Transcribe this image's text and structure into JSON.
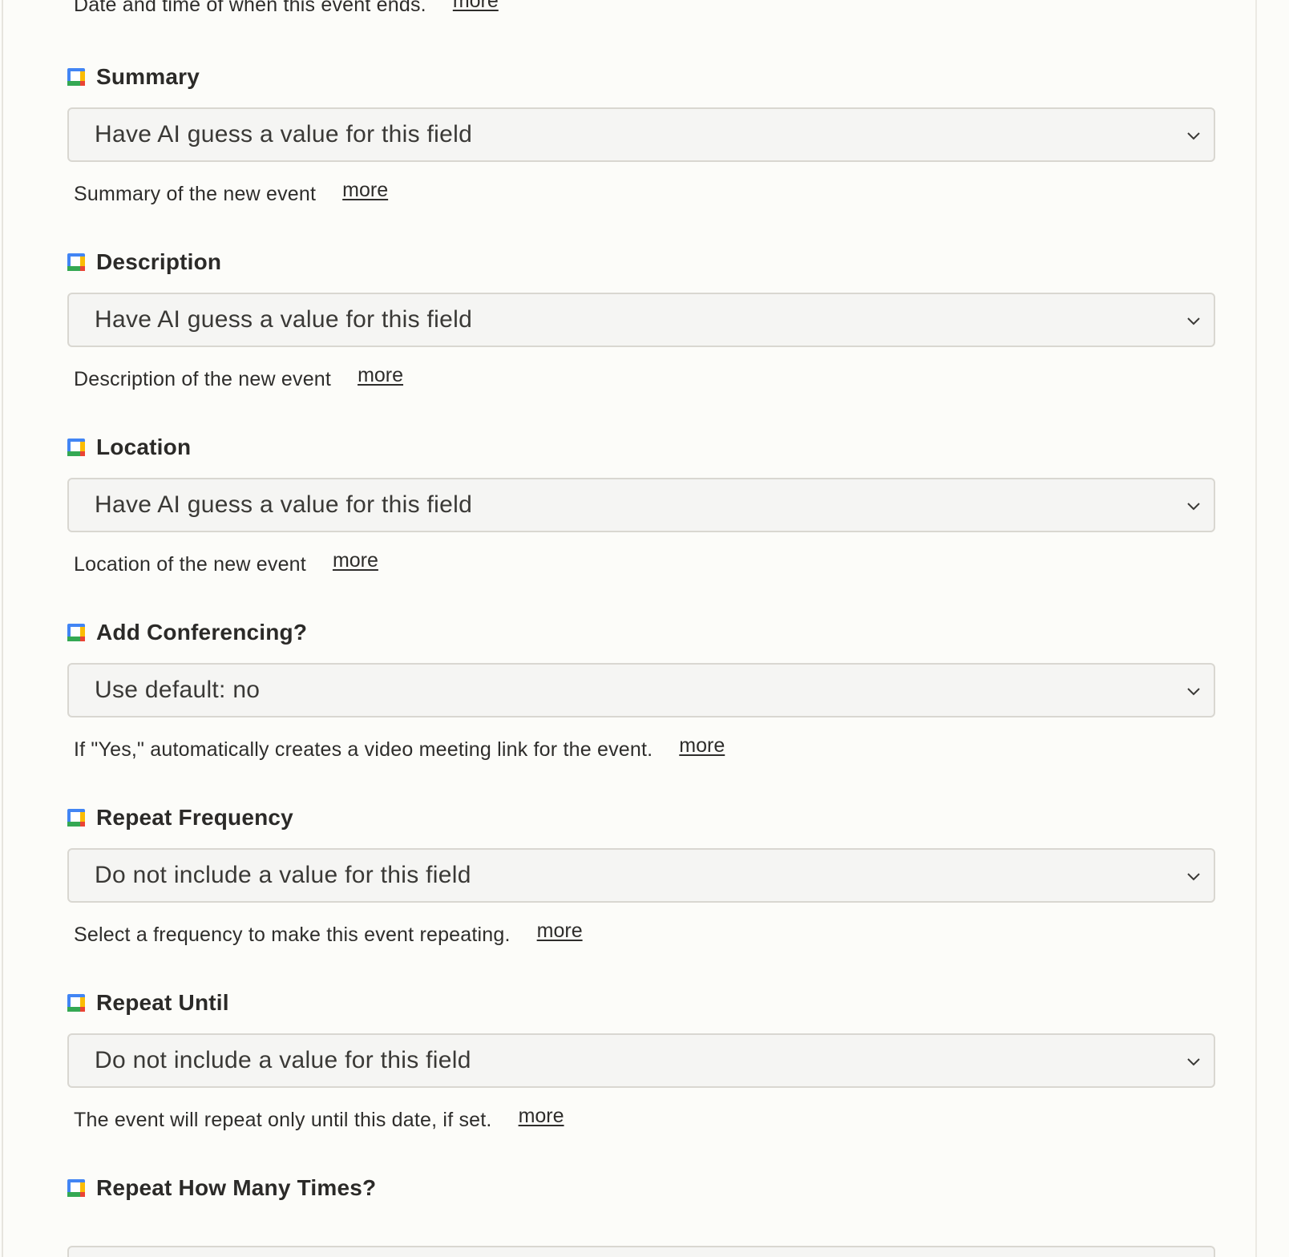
{
  "top_help": {
    "text": "Date and time of when this event ends.",
    "more": "more"
  },
  "fields": [
    {
      "label": "Summary",
      "value": "Have AI guess a value for this field",
      "help": "Summary of the new event",
      "more": "more"
    },
    {
      "label": "Description",
      "value": "Have AI guess a value for this field",
      "help": "Description of the new event",
      "more": "more"
    },
    {
      "label": "Location",
      "value": "Have AI guess a value for this field",
      "help": "Location of the new event",
      "more": "more"
    },
    {
      "label": "Add Conferencing?",
      "value": "Use default: no",
      "help": "If \"Yes,\" automatically creates a video meeting link for the event.",
      "more": "more"
    },
    {
      "label": "Repeat Frequency",
      "value": "Do not include a value for this field",
      "help": "Select a frequency to make this event repeating.",
      "more": "more"
    },
    {
      "label": "Repeat Until",
      "value": "Do not include a value for this field",
      "help": "The event will repeat only until this date, if set.",
      "more": "more"
    },
    {
      "label": "Repeat How Many Times?"
    }
  ],
  "icons": {
    "field_icon": "google-calendar-icon",
    "dropdown_icon": "chevron-down-icon"
  },
  "colors": {
    "background": "#fcfcf9",
    "select_background": "#f5f5f3",
    "select_border": "#d9d7d1",
    "icon_blue": "#4285f4",
    "icon_green": "#34a853",
    "icon_yellow": "#fbbc04",
    "icon_red": "#ea4335"
  }
}
